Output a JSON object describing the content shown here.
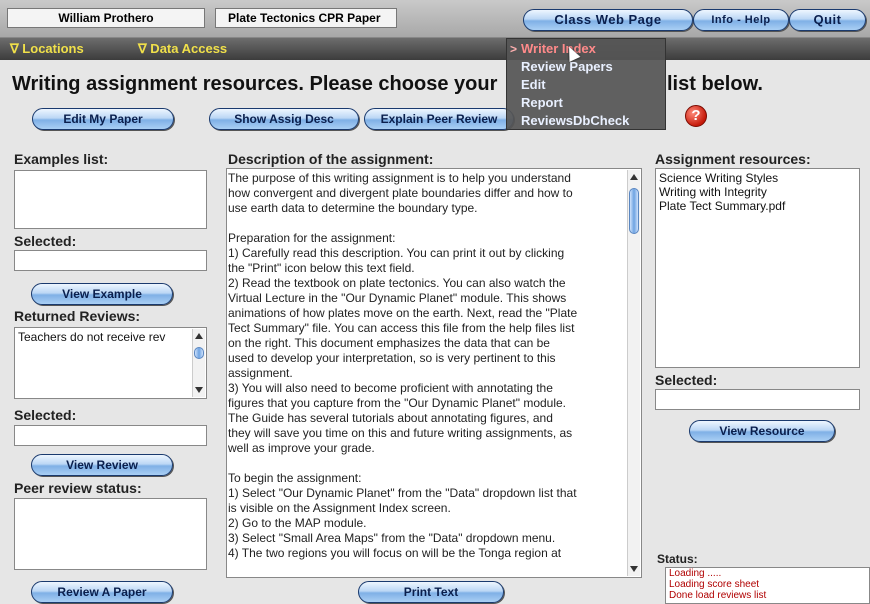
{
  "header": {
    "user_name": "William Prothero",
    "paper_title": "Plate Tectonics CPR Paper",
    "class_web_page": "Class Web Page",
    "info_help": "Info - Help",
    "quit": "Quit"
  },
  "menubar": {
    "locations": "∇ Locations",
    "data_access": "∇ Data Access"
  },
  "dropdown": {
    "pointer": ">",
    "items": [
      "Writer Index",
      "Review Papers",
      "Edit",
      "Report",
      "ReviewsDbCheck"
    ]
  },
  "heading": {
    "left": "Writing assignment resources. Please choose your",
    "right": "list below."
  },
  "toolbar": {
    "edit_my_paper": "Edit My Paper",
    "show_assig_desc": "Show Assig Desc",
    "explain_peer_review": "Explain Peer Review",
    "help_symbol": "?"
  },
  "left": {
    "examples_label": "Examples list:",
    "selected_label_1": "Selected:",
    "view_example": "View Example",
    "returned_reviews_label": "Returned Reviews:",
    "returned_reviews_text": "Teachers do not receive rev",
    "selected_label_2": "Selected:",
    "view_review": "View Review",
    "peer_review_status_label": "Peer review status:",
    "review_a_paper": "Review A Paper"
  },
  "center": {
    "description_label": "Description of the assignment:",
    "description_text": "The purpose of this writing assignment is to help you understand\nhow convergent and divergent plate boundaries differ and how to\nuse earth data to determine the boundary type.\n\nPreparation for the assignment:\n1) Carefully read this description. You can print it out by clicking\nthe \"Print\" icon below this text field.\n2) Read the textbook on plate tectonics. You can also watch the\nVirtual Lecture in the \"Our Dynamic Planet\" module. This shows\nanimations of how plates move on the earth. Next, read the \"Plate\nTect Summary\" file. You can access this file from the help files list\non the right. This document emphasizes the data that can be\nused to develop your interpretation, so is very pertinent to this\nassignment.\n3) You will also need to become proficient with annotating the\nfigures that you capture from the \"Our Dynamic Planet\" module.\nThe Guide has several tutorials about annotating figures, and\nthey will save you time on this and future writing assignments, as\nwell as improve your grade.\n\nTo begin the assignment:\n1) Select \"Our Dynamic Planet\" from the \"Data\" dropdown list that\nis visible on the Assignment Index screen.\n2) Go to the MAP module.\n3) Select \"Small Area Maps\" from the \"Data\" dropdown menu.\n4) The two regions you will focus on will be the Tonga region at",
    "print_text": "Print Text"
  },
  "right": {
    "resources_label": "Assignment resources:",
    "resources": [
      "Science Writing Styles",
      "Writing with Integrity",
      "Plate Tect Summary.pdf"
    ],
    "selected_label": "Selected:",
    "view_resource": "View Resource",
    "status_label": "Status:",
    "status_lines": [
      "Loading .....",
      "Loading score sheet",
      "Done load reviews list"
    ]
  }
}
